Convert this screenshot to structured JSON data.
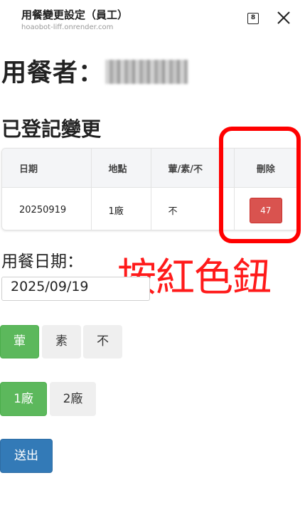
{
  "window": {
    "title": "用餐變更設定（員工）",
    "url": "hoaobot-liff.onrender.com",
    "tab_count": "8",
    "close_icon": "close-icon"
  },
  "diner": {
    "label": "用餐者："
  },
  "changes": {
    "title": "已登記變更",
    "headers": [
      "日期",
      "地點",
      "葷/素/不",
      "刪除"
    ],
    "rows": [
      {
        "date": "20250919",
        "location": "1廠",
        "meal": "不",
        "delete_label": "47"
      }
    ]
  },
  "annotation": "按紅色鈕",
  "form": {
    "date_label": "用餐日期：",
    "date_value": "2025/09/19",
    "meal_options": [
      "葷",
      "素",
      "不"
    ],
    "location_options": [
      "1廠",
      "2廠"
    ],
    "submit_label": "送出"
  },
  "colors": {
    "selected": "#5cb85c",
    "delete": "#d9534f",
    "submit": "#337ab7",
    "annotation": "#ff0000"
  }
}
